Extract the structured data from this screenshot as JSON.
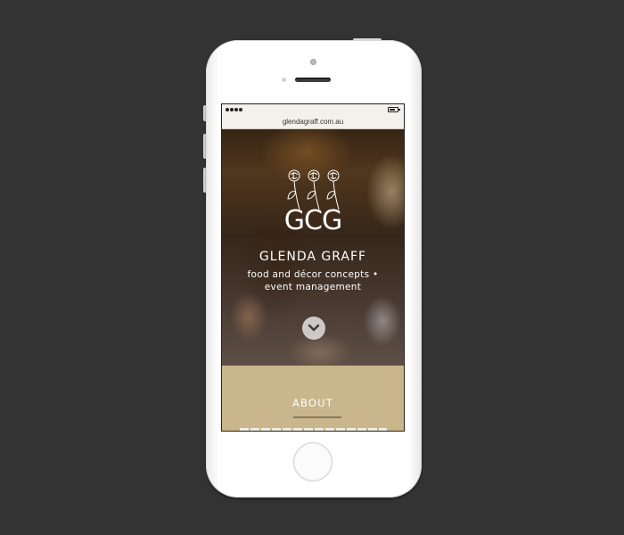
{
  "browser": {
    "url": "glendagraff.com.au"
  },
  "hero": {
    "logo": "GCG",
    "brand_name": "GLENDA GRAFF",
    "tagline_line1": "food and décor concepts •",
    "tagline_line2": "event management"
  },
  "about": {
    "title": "ABOUT"
  },
  "icons": {
    "scroll": "chevron-down-icon",
    "logo_mark": "roses-logo-icon",
    "battery": "battery-icon",
    "signal": "signal-dots-icon"
  },
  "colors": {
    "background": "#333333",
    "about_section": "#c9b68c",
    "about_underline": "#8a7a5a",
    "text_light": "#ffffff"
  }
}
